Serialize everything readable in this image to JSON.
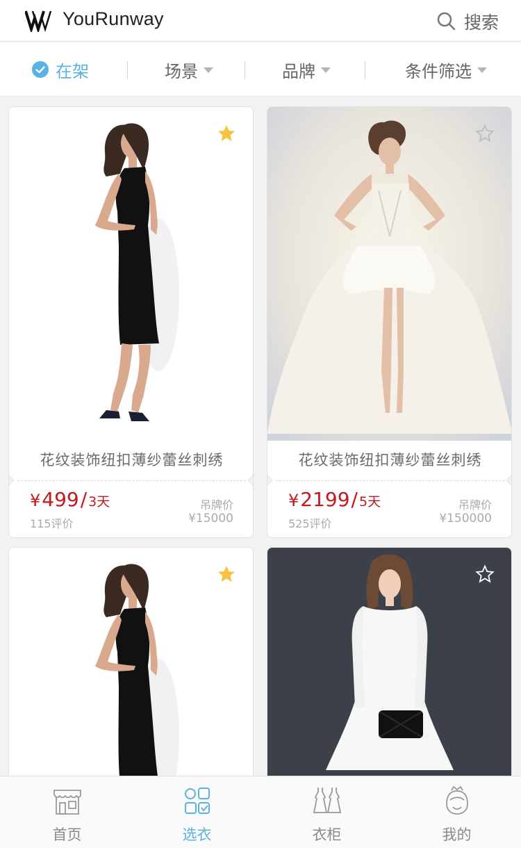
{
  "header": {
    "app_title": "YouRunway",
    "search_label": "搜索"
  },
  "filters": {
    "on_shelf": "在架",
    "scene": "场景",
    "brand": "品牌",
    "conditions": "条件筛选"
  },
  "products": [
    {
      "name": "花纹装饰纽扣薄纱蕾丝刺绣",
      "currency": "¥",
      "price": "499",
      "period": "3天",
      "reviews": "115评价",
      "tag_label": "吊牌价",
      "tag_price": "¥15000",
      "favorited": true
    },
    {
      "name": "花纹装饰纽扣薄纱蕾丝刺绣",
      "currency": "¥",
      "price": "2199",
      "period": "5天",
      "reviews": "525评价",
      "tag_label": "吊牌价",
      "tag_price": "¥150000",
      "favorited": false
    },
    {
      "favorited": true
    },
    {
      "favorited": false
    }
  ],
  "nav": {
    "home": "首页",
    "select": "选衣",
    "wardrobe": "衣柜",
    "mine": "我的"
  },
  "colors": {
    "accent": "#5ab2e2",
    "price": "#c8161d",
    "star": "#f5c242"
  }
}
